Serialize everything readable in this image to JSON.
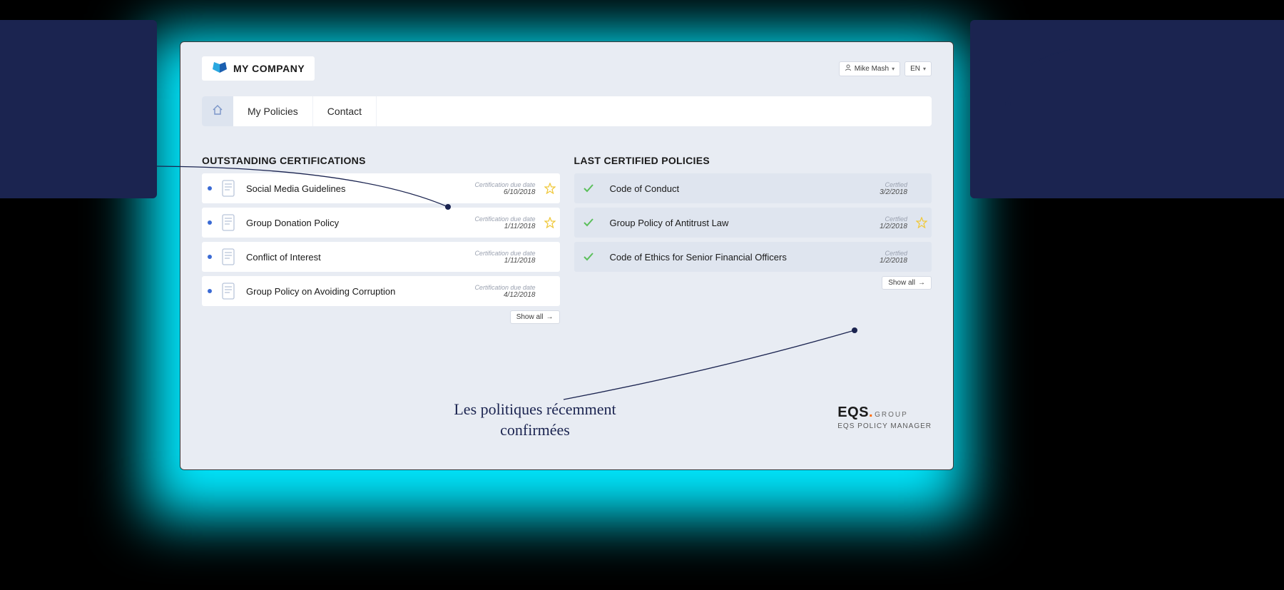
{
  "header": {
    "company_name": "MY COMPANY",
    "user_name": "Mike Mash",
    "lang": "EN"
  },
  "nav": {
    "home": "Home",
    "items": [
      "My Policies",
      "Contact"
    ]
  },
  "outstanding": {
    "title": "OUTSTANDING CERTIFICATIONS",
    "meta_label": "Certification due date",
    "show_all": "Show all",
    "items": [
      {
        "title": "Social Media Guidelines",
        "date": "6/10/2018",
        "starred": true
      },
      {
        "title": "Group Donation Policy",
        "date": "1/11/2018",
        "starred": true
      },
      {
        "title": "Conflict of Interest",
        "date": "1/11/2018",
        "starred": false
      },
      {
        "title": "Group Policy on Avoiding Corruption",
        "date": "4/12/2018",
        "starred": false
      }
    ]
  },
  "certified": {
    "title": "LAST CERTIFIED POLICIES",
    "meta_label": "Certfied",
    "show_all": "Show all",
    "items": [
      {
        "title": "Code of Conduct",
        "date": "3/2/2018",
        "starred": false
      },
      {
        "title": "Group Policy of Antitrust Law",
        "date": "1/2/2018",
        "starred": true
      },
      {
        "title": "Code of Ethics for Senior Financial Officers",
        "date": "1/2/2018",
        "starred": false
      }
    ]
  },
  "brand": {
    "name": "EQS",
    "group": "GROUP",
    "product": "EQS POLICY MANAGER"
  },
  "annotations": {
    "center": "Les politiques récemment confirmées"
  }
}
